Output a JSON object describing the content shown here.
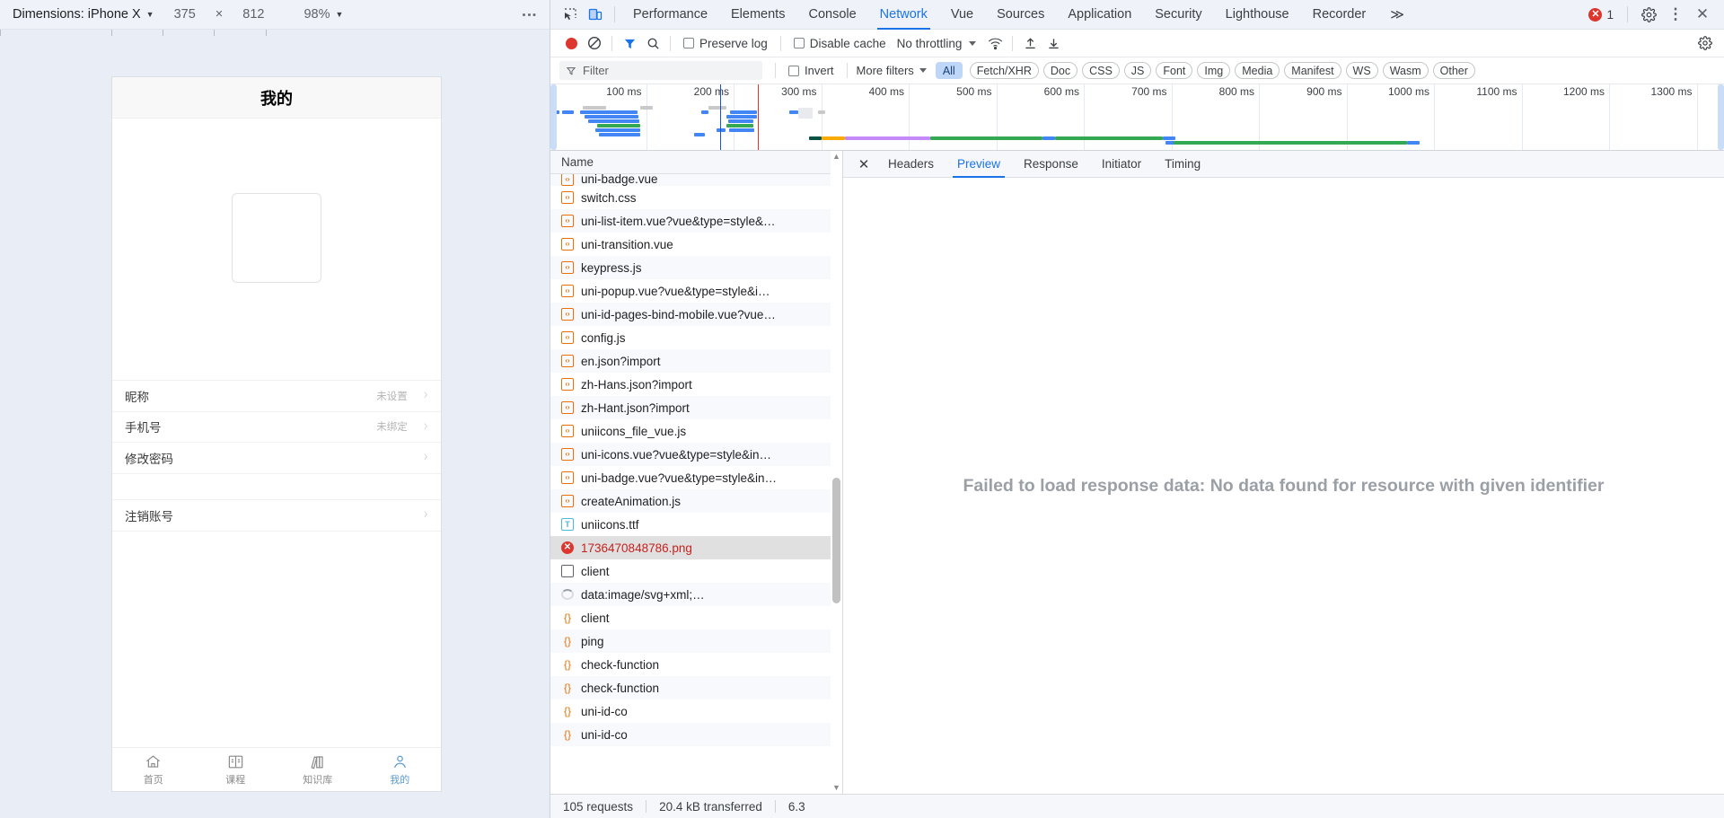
{
  "device_toolbar": {
    "dimensions_label": "Dimensions: iPhone X",
    "width": "375",
    "times": "×",
    "height": "812",
    "zoom": "98%",
    "menu_icon": "kebab-menu-icon"
  },
  "phone": {
    "title": "我的",
    "rows_group1": [
      {
        "label": "昵称",
        "value": "未设置"
      },
      {
        "label": "手机号",
        "value": "未绑定"
      },
      {
        "label": "修改密码",
        "value": ""
      }
    ],
    "rows_group2": [
      {
        "label": "注销账号",
        "value": ""
      }
    ],
    "tabbar": [
      {
        "label": "首页",
        "icon": "home-icon",
        "active": false
      },
      {
        "label": "课程",
        "icon": "book-icon",
        "active": false
      },
      {
        "label": "知识库",
        "icon": "library-icon",
        "active": false
      },
      {
        "label": "我的",
        "icon": "person-icon",
        "active": true
      }
    ]
  },
  "devtools": {
    "tabs": [
      {
        "label": "Performance",
        "active": false
      },
      {
        "label": "Elements",
        "active": false
      },
      {
        "label": "Console",
        "active": false
      },
      {
        "label": "Network",
        "active": true
      },
      {
        "label": "Vue",
        "active": false
      },
      {
        "label": "Sources",
        "active": false
      },
      {
        "label": "Application",
        "active": false
      },
      {
        "label": "Security",
        "active": false
      },
      {
        "label": "Lighthouse",
        "active": false
      },
      {
        "label": "Recorder",
        "active": false
      }
    ],
    "overflow_label": "≫",
    "error_count": "1",
    "inspect_icon": "inspect-element-icon",
    "device_toggle_icon": "device-toolbar-icon",
    "settings_icon": "gear-icon",
    "more_icon": "kebab-menu-icon",
    "close_icon": "close-icon"
  },
  "network_toolbar": {
    "record_icon": "record-stop-icon",
    "clear_icon": "clear-icon",
    "filter_icon": "funnel-icon",
    "search_icon": "search-icon",
    "preserve_log": "Preserve log",
    "preserve_log_checked": false,
    "disable_cache": "Disable cache",
    "disable_cache_checked": false,
    "throttling": "No throttling",
    "wifi_icon": "network-conditions-icon",
    "import_icon": "import-har-icon",
    "export_icon": "export-har-icon"
  },
  "filter_row": {
    "filter_placeholder": "Filter",
    "invert": "Invert",
    "invert_checked": false,
    "more_filters": "More filters",
    "types": [
      {
        "label": "All",
        "active": true
      },
      {
        "label": "Fetch/XHR",
        "active": false
      },
      {
        "label": "Doc",
        "active": false
      },
      {
        "label": "CSS",
        "active": false
      },
      {
        "label": "JS",
        "active": false
      },
      {
        "label": "Font",
        "active": false
      },
      {
        "label": "Img",
        "active": false
      },
      {
        "label": "Media",
        "active": false
      },
      {
        "label": "Manifest",
        "active": false
      },
      {
        "label": "WS",
        "active": false
      },
      {
        "label": "Wasm",
        "active": false
      },
      {
        "label": "Other",
        "active": false
      }
    ]
  },
  "overview": {
    "ticks": [
      "100 ms",
      "200 ms",
      "300 ms",
      "400 ms",
      "500 ms",
      "600 ms",
      "700 ms",
      "800 ms",
      "900 ms",
      "1000 ms",
      "1100 ms",
      "1200 ms",
      "1300 ms"
    ],
    "dom_content_loaded_color": "#1a56c4",
    "load_event_color": "#dc362e"
  },
  "request_list": {
    "column_header": "Name",
    "rows": [
      {
        "name": "uni-badge.vue",
        "icon": "code-icon",
        "state": "clipped"
      },
      {
        "name": "switch.css",
        "icon": "code-icon",
        "state": "normal"
      },
      {
        "name": "uni-list-item.vue?vue&type=style&…",
        "icon": "code-icon",
        "state": "normal"
      },
      {
        "name": "uni-transition.vue",
        "icon": "code-icon",
        "state": "normal"
      },
      {
        "name": "keypress.js",
        "icon": "code-icon",
        "state": "normal"
      },
      {
        "name": "uni-popup.vue?vue&type=style&i…",
        "icon": "code-icon",
        "state": "normal"
      },
      {
        "name": "uni-id-pages-bind-mobile.vue?vue…",
        "icon": "code-icon",
        "state": "normal"
      },
      {
        "name": "config.js",
        "icon": "code-icon",
        "state": "normal"
      },
      {
        "name": "en.json?import",
        "icon": "code-icon",
        "state": "normal"
      },
      {
        "name": "zh-Hans.json?import",
        "icon": "code-icon",
        "state": "normal"
      },
      {
        "name": "zh-Hant.json?import",
        "icon": "code-icon",
        "state": "normal"
      },
      {
        "name": "uniicons_file_vue.js",
        "icon": "code-icon",
        "state": "normal"
      },
      {
        "name": "uni-icons.vue?vue&type=style&in…",
        "icon": "code-icon",
        "state": "normal"
      },
      {
        "name": "uni-badge.vue?vue&type=style&in…",
        "icon": "code-icon",
        "state": "normal"
      },
      {
        "name": "createAnimation.js",
        "icon": "code-icon",
        "state": "normal"
      },
      {
        "name": "uniicons.ttf",
        "icon": "font-icon",
        "state": "normal"
      },
      {
        "name": "1736470848786.png",
        "icon": "error-icon",
        "state": "selected"
      },
      {
        "name": "client",
        "icon": "document-icon",
        "state": "normal"
      },
      {
        "name": "data:image/svg+xml;…",
        "icon": "pending-icon",
        "state": "normal"
      },
      {
        "name": "client",
        "icon": "json-icon",
        "state": "normal"
      },
      {
        "name": "ping",
        "icon": "json-icon",
        "state": "normal"
      },
      {
        "name": "check-function",
        "icon": "json-icon",
        "state": "normal"
      },
      {
        "name": "check-function",
        "icon": "json-icon",
        "state": "normal"
      },
      {
        "name": "uni-id-co",
        "icon": "json-icon",
        "state": "normal"
      },
      {
        "name": "uni-id-co",
        "icon": "json-icon",
        "state": "normal"
      }
    ]
  },
  "detail": {
    "close_icon": "close-icon",
    "tabs": [
      {
        "label": "Headers",
        "active": false
      },
      {
        "label": "Preview",
        "active": true
      },
      {
        "label": "Response",
        "active": false
      },
      {
        "label": "Initiator",
        "active": false
      },
      {
        "label": "Timing",
        "active": false
      }
    ],
    "message": "Failed to load response data: No data found for resource with given identifier"
  },
  "status_bar": {
    "requests": "105 requests",
    "transferred": "20.4 kB transferred",
    "resources": "6.3"
  }
}
